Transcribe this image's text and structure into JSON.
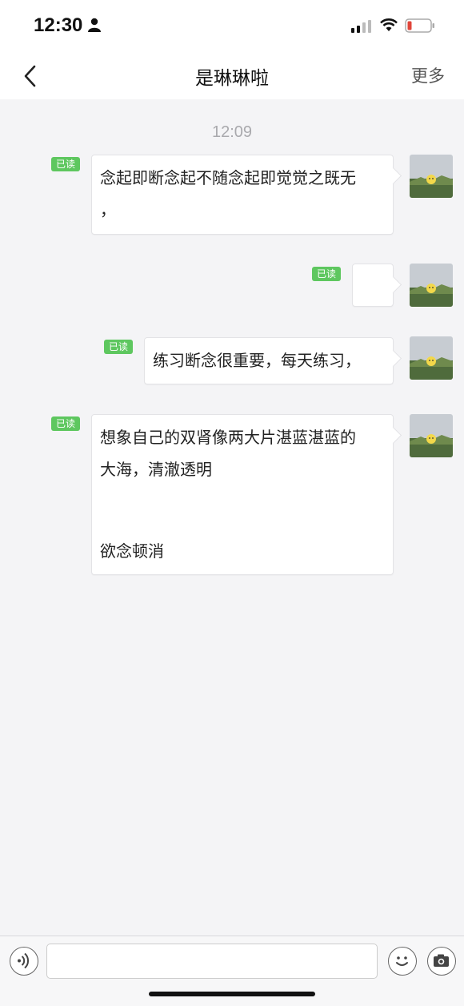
{
  "status": {
    "time": "12:30"
  },
  "nav": {
    "title": "是琳琳啦",
    "more_label": "更多"
  },
  "conversation": {
    "timestamp": "12:09",
    "read_label": "已读",
    "messages": [
      {
        "lines": [
          "念起即断念起不随念起即觉觉之既无",
          "，"
        ]
      },
      {
        "lines": []
      },
      {
        "lines": [
          "练习断念很重要，每天练习，"
        ]
      },
      {
        "lines": [
          "想象自己的双肾像两大片湛蓝湛蓝的",
          "大海，清澈透明",
          "",
          "欲念顿消"
        ]
      }
    ]
  },
  "input": {
    "value": ""
  },
  "icons": [
    "back-arrow-icon",
    "person-icon",
    "signal-icon",
    "wifi-icon",
    "battery-icon",
    "voice-icon",
    "emoji-icon",
    "camera-icon"
  ],
  "colors": {
    "read_badge": "#5ec75f",
    "battery_low": "#e0453a"
  }
}
